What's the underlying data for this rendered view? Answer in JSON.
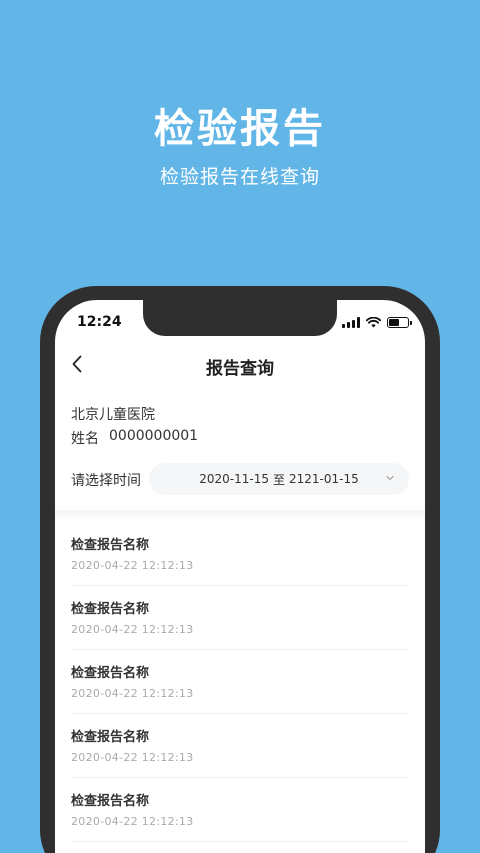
{
  "hero": {
    "title": "检验报告",
    "subtitle": "检验报告在线查询"
  },
  "status_bar": {
    "time": "12:24",
    "icons": [
      "signal-icon",
      "wifi-icon",
      "battery-icon"
    ]
  },
  "nav": {
    "back_icon": "chevron-left-icon",
    "title": "报告查询"
  },
  "patient": {
    "hospital": "北京儿童医院",
    "name_label": "姓名",
    "name_value": "0000000001"
  },
  "time_filter": {
    "label": "请选择时间",
    "start": "2020-11-15",
    "separator": "至",
    "end": "2121-01-15",
    "dropdown_icon": "chevron-down-icon"
  },
  "reports": [
    {
      "name": "检查报告名称",
      "time": "2020-04-22 12:12:13"
    },
    {
      "name": "检查报告名称",
      "time": "2020-04-22 12:12:13"
    },
    {
      "name": "检查报告名称",
      "time": "2020-04-22 12:12:13"
    },
    {
      "name": "检查报告名称",
      "time": "2020-04-22 12:12:13"
    },
    {
      "name": "检查报告名称",
      "time": "2020-04-22 12:12:13"
    }
  ],
  "colors": {
    "background": "#62B6E7",
    "phone_frame": "#2F2F2F",
    "muted_text": "#AAAAAA"
  }
}
